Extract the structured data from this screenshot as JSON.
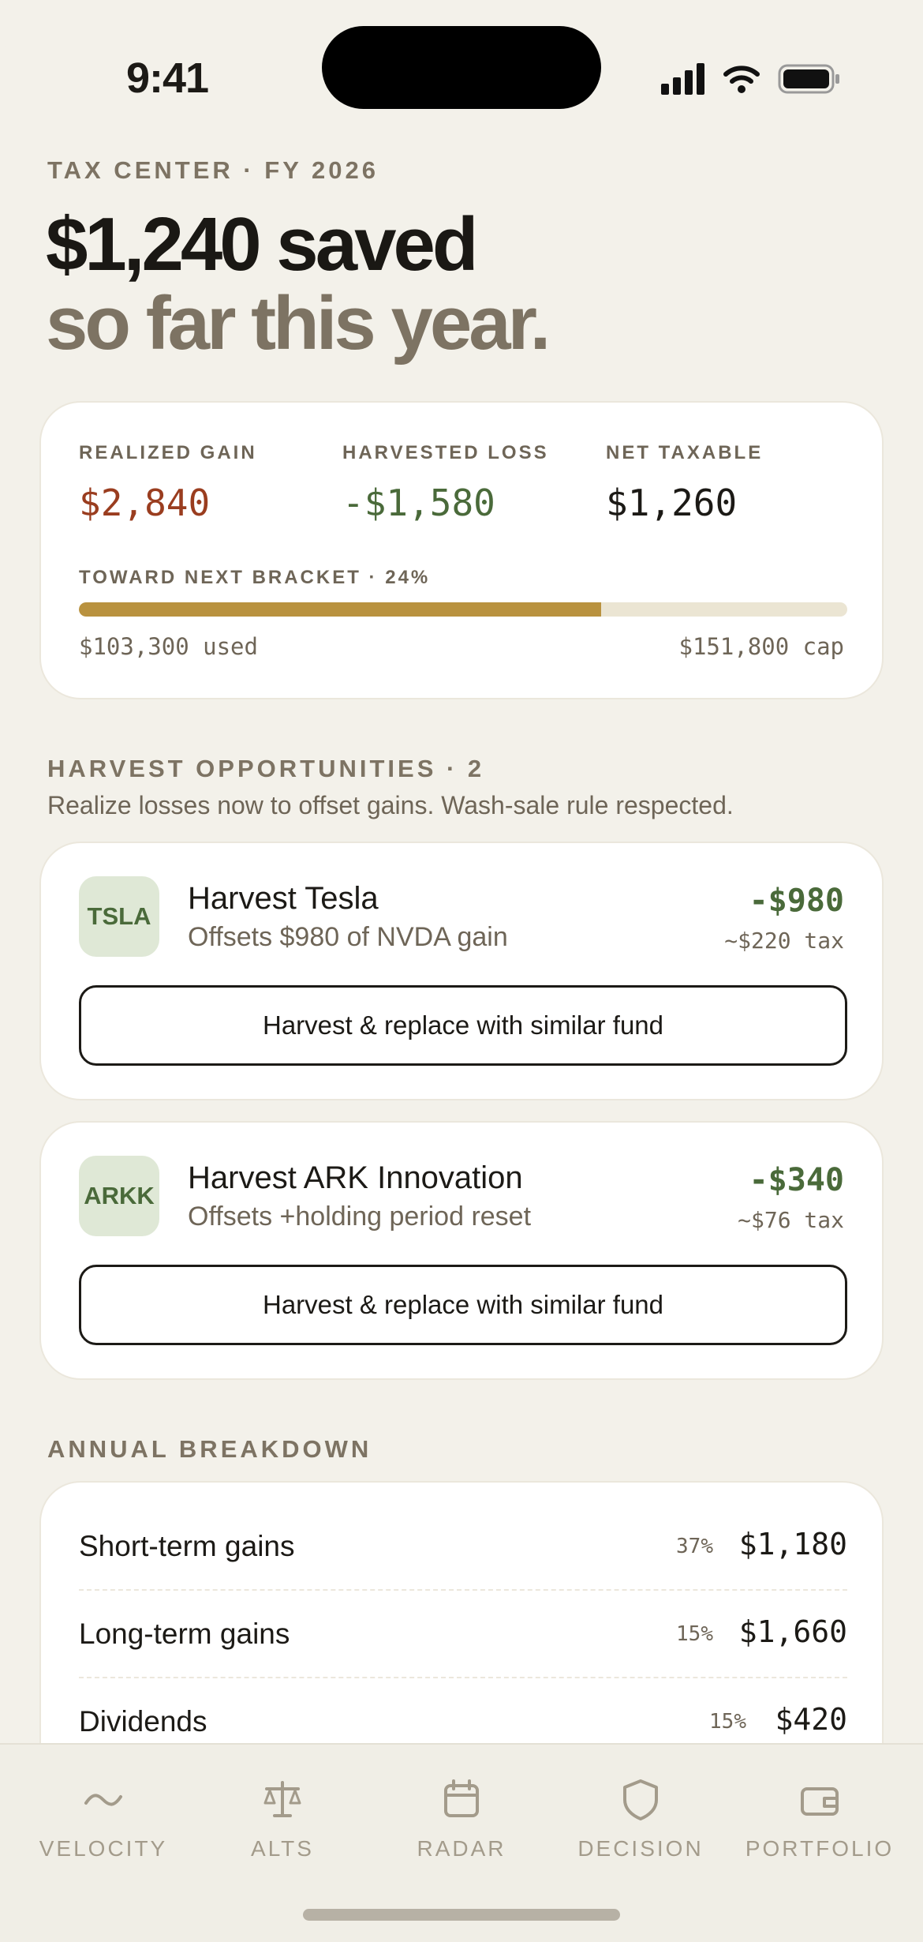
{
  "status_bar": {
    "time": "9:41"
  },
  "header": {
    "eyebrow": "TAX CENTER · FY 2026",
    "headline_line1": "$1,240 saved",
    "headline_line2": "so far this year."
  },
  "summary": {
    "stats": [
      {
        "label": "REALIZED GAIN",
        "value": "$2,840",
        "color": "#9a3d1f"
      },
      {
        "label": "HARVESTED LOSS",
        "value": "-$1,580",
        "color": "#4a6a3a"
      },
      {
        "label": "NET TAXABLE",
        "value": "$1,260",
        "color": "#1c1a16"
      }
    ],
    "bracket_label": "TOWARD NEXT BRACKET · 24%",
    "progress_fraction": 0.68,
    "used_label": "$103,300 used",
    "cap_label": "$151,800 cap"
  },
  "opportunities": {
    "title": "HARVEST OPPORTUNITIES · 2",
    "subtitle": "Realize losses now to offset gains. Wash-sale rule respected.",
    "items": [
      {
        "ticker": "TSLA",
        "title": "Harvest Tesla",
        "subtitle": "Offsets $980 of NVDA gain",
        "amount": "-$980",
        "tax": "~$220 tax",
        "button": "Harvest & replace with similar fund"
      },
      {
        "ticker": "ARKK",
        "title": "Harvest ARK Innovation",
        "subtitle": "Offsets +holding period reset",
        "amount": "-$340",
        "tax": "~$76 tax",
        "button": "Harvest & replace with similar fund"
      }
    ]
  },
  "breakdown": {
    "title": "ANNUAL BREAKDOWN",
    "rows": [
      {
        "label": "Short-term gains",
        "pct": "37%",
        "value": "$1,180"
      },
      {
        "label": "Long-term gains",
        "pct": "15%",
        "value": "$1,660"
      },
      {
        "label": "Dividends",
        "pct": "15%",
        "value": "$420"
      }
    ]
  },
  "tabbar": {
    "tabs": [
      {
        "label": "VELOCITY",
        "icon": "wave-icon"
      },
      {
        "label": "ALTS",
        "icon": "scale-icon"
      },
      {
        "label": "RADAR",
        "icon": "calendar-icon"
      },
      {
        "label": "DECISION",
        "icon": "shield-icon"
      },
      {
        "label": "PORTFOLIO",
        "icon": "wallet-icon"
      }
    ]
  }
}
